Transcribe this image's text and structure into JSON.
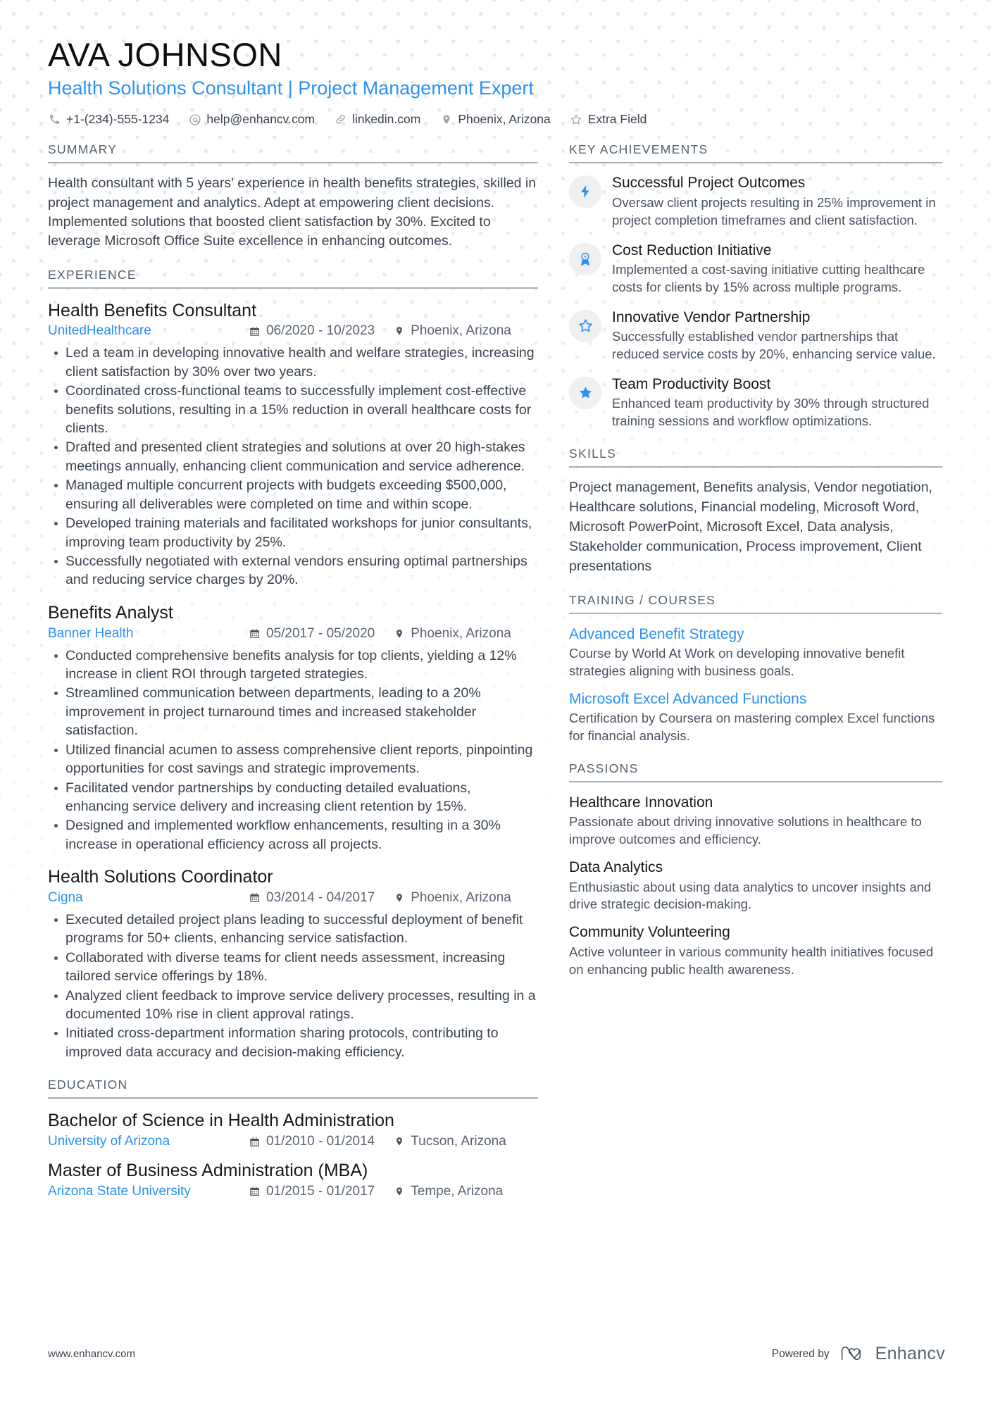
{
  "header": {
    "name": "AVA JOHNSON",
    "headline": "Health Solutions Consultant | Project Management Expert",
    "contacts": [
      {
        "icon": "phone-icon",
        "text": "+1-(234)-555-1234"
      },
      {
        "icon": "email-icon",
        "text": "help@enhancv.com"
      },
      {
        "icon": "link-icon",
        "text": "linkedin.com"
      },
      {
        "icon": "location-pin-icon",
        "text": "Phoenix, Arizona"
      },
      {
        "icon": "star-outline-icon",
        "text": "Extra Field"
      }
    ]
  },
  "left": {
    "summary": {
      "title": "SUMMARY",
      "text": "Health consultant with 5 years' experience in health benefits strategies, skilled in project management and analytics. Adept at empowering client decisions. Implemented solutions that boosted client satisfaction by 30%. Excited to leverage Microsoft Office Suite excellence in enhancing outcomes."
    },
    "experience": {
      "title": "EXPERIENCE",
      "entries": [
        {
          "role": "Health Benefits Consultant",
          "org": "UnitedHealthcare",
          "dates": "06/2020 - 10/2023",
          "location": "Phoenix, Arizona",
          "bullets": [
            "Led a team in developing innovative health and welfare strategies, increasing client satisfaction by 30% over two years.",
            "Coordinated cross-functional teams to successfully implement cost-effective benefits solutions, resulting in a 15% reduction in overall healthcare costs for clients.",
            "Drafted and presented client strategies and solutions at over 20 high-stakes meetings annually, enhancing client communication and service adherence.",
            "Managed multiple concurrent projects with budgets exceeding $500,000, ensuring all deliverables were completed on time and within scope.",
            "Developed training materials and facilitated workshops for junior consultants, improving team productivity by 25%.",
            "Successfully negotiated with external vendors ensuring optimal partnerships and reducing service charges by 20%."
          ]
        },
        {
          "role": "Benefits Analyst",
          "org": "Banner Health",
          "dates": "05/2017 - 05/2020",
          "location": "Phoenix, Arizona",
          "bullets": [
            "Conducted comprehensive benefits analysis for top clients, yielding a 12% increase in client ROI through targeted strategies.",
            "Streamlined communication between departments, leading to a 20% improvement in project turnaround times and increased stakeholder satisfaction.",
            "Utilized financial acumen to assess comprehensive client reports, pinpointing opportunities for cost savings and strategic improvements.",
            "Facilitated vendor partnerships by conducting detailed evaluations, enhancing service delivery and increasing client retention by 15%.",
            "Designed and implemented workflow enhancements, resulting in a 30% increase in operational efficiency across all projects."
          ]
        },
        {
          "role": "Health Solutions Coordinator",
          "org": "Cigna",
          "dates": "03/2014 - 04/2017",
          "location": "Phoenix, Arizona",
          "bullets": [
            "Executed detailed project plans leading to successful deployment of benefit programs for 50+ clients, enhancing service satisfaction.",
            "Collaborated with diverse teams for client needs assessment, increasing tailored service offerings by 18%.",
            "Analyzed client feedback to improve service delivery processes, resulting in a documented 10% rise in client approval ratings.",
            "Initiated cross-department information sharing protocols, contributing to improved data accuracy and decision-making efficiency."
          ]
        }
      ]
    },
    "education": {
      "title": "EDUCATION",
      "entries": [
        {
          "degree": "Bachelor of Science in Health Administration",
          "school": "University of Arizona",
          "dates": "01/2010 - 01/2014",
          "location": "Tucson, Arizona"
        },
        {
          "degree": "Master of Business Administration (MBA)",
          "school": "Arizona State University",
          "dates": "01/2015 - 01/2017",
          "location": "Tempe, Arizona"
        }
      ]
    }
  },
  "right": {
    "achievements": {
      "title": "KEY ACHIEVEMENTS",
      "items": [
        {
          "icon": "lightning-bolt-icon",
          "title": "Successful Project Outcomes",
          "desc": "Oversaw client projects resulting in 25% improvement in project completion timeframes and client satisfaction."
        },
        {
          "icon": "award-medal-icon",
          "title": "Cost Reduction Initiative",
          "desc": "Implemented a cost-saving initiative cutting healthcare costs for clients by 15% across multiple programs."
        },
        {
          "icon": "star-outline-icon",
          "title": "Innovative Vendor Partnership",
          "desc": "Successfully established vendor partnerships that reduced service costs by 20%, enhancing service value."
        },
        {
          "icon": "star-filled-icon",
          "title": "Team Productivity Boost",
          "desc": "Enhanced team productivity by 30% through structured training sessions and workflow optimizations."
        }
      ]
    },
    "skills": {
      "title": "SKILLS",
      "text": "Project management, Benefits analysis, Vendor negotiation, Healthcare solutions, Financial modeling, Microsoft Word, Microsoft PowerPoint, Microsoft Excel, Data analysis, Stakeholder communication, Process improvement, Client presentations"
    },
    "training": {
      "title": "TRAINING / COURSES",
      "items": [
        {
          "name": "Advanced Benefit Strategy",
          "desc": "Course by World At Work on developing innovative benefit strategies aligning with business goals."
        },
        {
          "name": "Microsoft Excel Advanced Functions",
          "desc": "Certification by Coursera on mastering complex Excel functions for financial analysis."
        }
      ]
    },
    "passions": {
      "title": "PASSIONS",
      "items": [
        {
          "name": "Healthcare Innovation",
          "desc": "Passionate about driving innovative solutions in healthcare to improve outcomes and efficiency."
        },
        {
          "name": "Data Analytics",
          "desc": "Enthusiastic about using data analytics to uncover insights and drive strategic decision-making."
        },
        {
          "name": "Community Volunteering",
          "desc": "Active volunteer in various community health initiatives focused on enhancing public health awareness."
        }
      ]
    }
  },
  "footer": {
    "url": "www.enhancv.com",
    "powered_by": "Powered by",
    "brand": "Enhancv"
  },
  "colors": {
    "accent": "#2b91f5",
    "text": "#3a4450",
    "heading": "#53616f",
    "rule": "#a9b0b7",
    "icon_bg": "#eff0f1"
  }
}
